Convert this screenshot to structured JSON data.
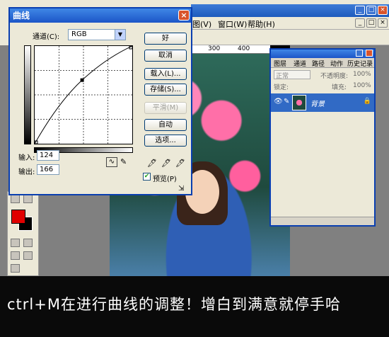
{
  "photoshop": {
    "window_buttons": [
      "_",
      "□",
      "×"
    ],
    "menu": [
      "图(V)",
      "窗口(W)",
      "帮助(H)"
    ],
    "ruler": [
      "300",
      "400"
    ]
  },
  "curves_dialog": {
    "title": "曲线",
    "channel_label": "通道(C):",
    "channel_value": "RGB",
    "input_label": "输入:",
    "input_value": "124",
    "output_label": "输出:",
    "output_value": "166",
    "buttons": {
      "ok": "好",
      "cancel": "取消",
      "load": "载入(L)...",
      "save": "存储(S)...",
      "smooth": "平滑(M)",
      "auto": "自动",
      "options": "选项..."
    },
    "preview_label": "预览(P)",
    "preview_checked": true,
    "curve_point": {
      "input": 124,
      "output": 166
    }
  },
  "layers_panel": {
    "tabs": [
      "图层",
      "通道",
      "路径",
      "动作",
      "历史记录"
    ],
    "blend_mode": "正常",
    "opacity_label": "不透明度:",
    "opacity_value": "100%",
    "lock_label": "锁定:",
    "fill_label": "填充:",
    "fill_value": "100%",
    "layer_name": "背景"
  },
  "caption": {
    "text": "ctrl+M在进行曲线的调整！增白到满意就停手哈"
  },
  "colors": {
    "foreground": "#e00000",
    "background": "#000000",
    "title_blue": "#1c55c7"
  }
}
